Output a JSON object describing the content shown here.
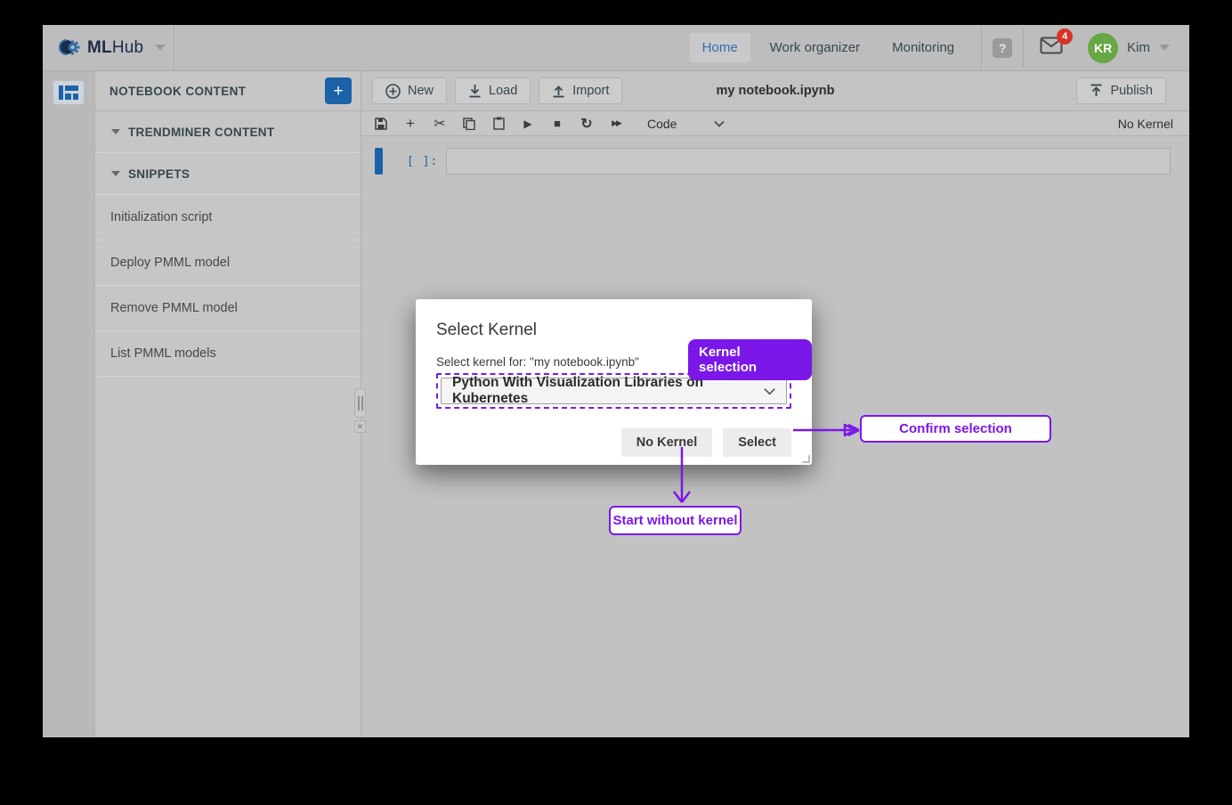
{
  "topbar": {
    "brand_ml": "ML",
    "brand_hub": "Hub",
    "nav": {
      "home": "Home",
      "work_organizer": "Work organizer",
      "monitoring": "Monitoring"
    },
    "help_glyph": "?",
    "mail_badge": "4",
    "avatar_initials": "KR",
    "user_name": "Kim"
  },
  "sidebar": {
    "header": "NOTEBOOK CONTENT",
    "add_button": "+",
    "group_trendminer": "TRENDMINER CONTENT",
    "group_snippets": "SNIPPETS",
    "items": [
      "Initialization script",
      "Deploy PMML model",
      "Remove PMML model",
      "List PMML models"
    ]
  },
  "toolbar": {
    "new_label": "New",
    "load_label": "Load",
    "import_label": "Import",
    "notebook_title": "my notebook.ipynb",
    "publish_label": "Publish"
  },
  "notebook_toolbar": {
    "cell_type": "Code",
    "kernel_status": "No Kernel",
    "icon_names": [
      "save-icon",
      "add-cell-icon",
      "cut-icon",
      "copy-icon",
      "paste-icon",
      "run-icon",
      "stop-icon",
      "restart-icon",
      "fast-forward-icon"
    ]
  },
  "cell": {
    "prompt": "[ ]:"
  },
  "dialog": {
    "title": "Select Kernel",
    "label": "Select kernel for: \"my notebook.ipynb\"",
    "kernel_value": "Python With Visualization Libraries on Kubernetes",
    "no_kernel_button": "No Kernel",
    "select_button": "Select"
  },
  "annotations": {
    "kernel_selection": "Kernel selection",
    "confirm_selection": "Confirm selection",
    "start_without_kernel": "Start without kernel"
  },
  "colors": {
    "annotation_purple": "#7b17e8",
    "accent_blue": "#1b62a9",
    "home_active_blue": "#2e6fb0",
    "avatar_green": "#67a744",
    "badge_red": "#d63426",
    "topbar_gray": "#bdbdbd",
    "dialog_white": "#ffffff"
  }
}
